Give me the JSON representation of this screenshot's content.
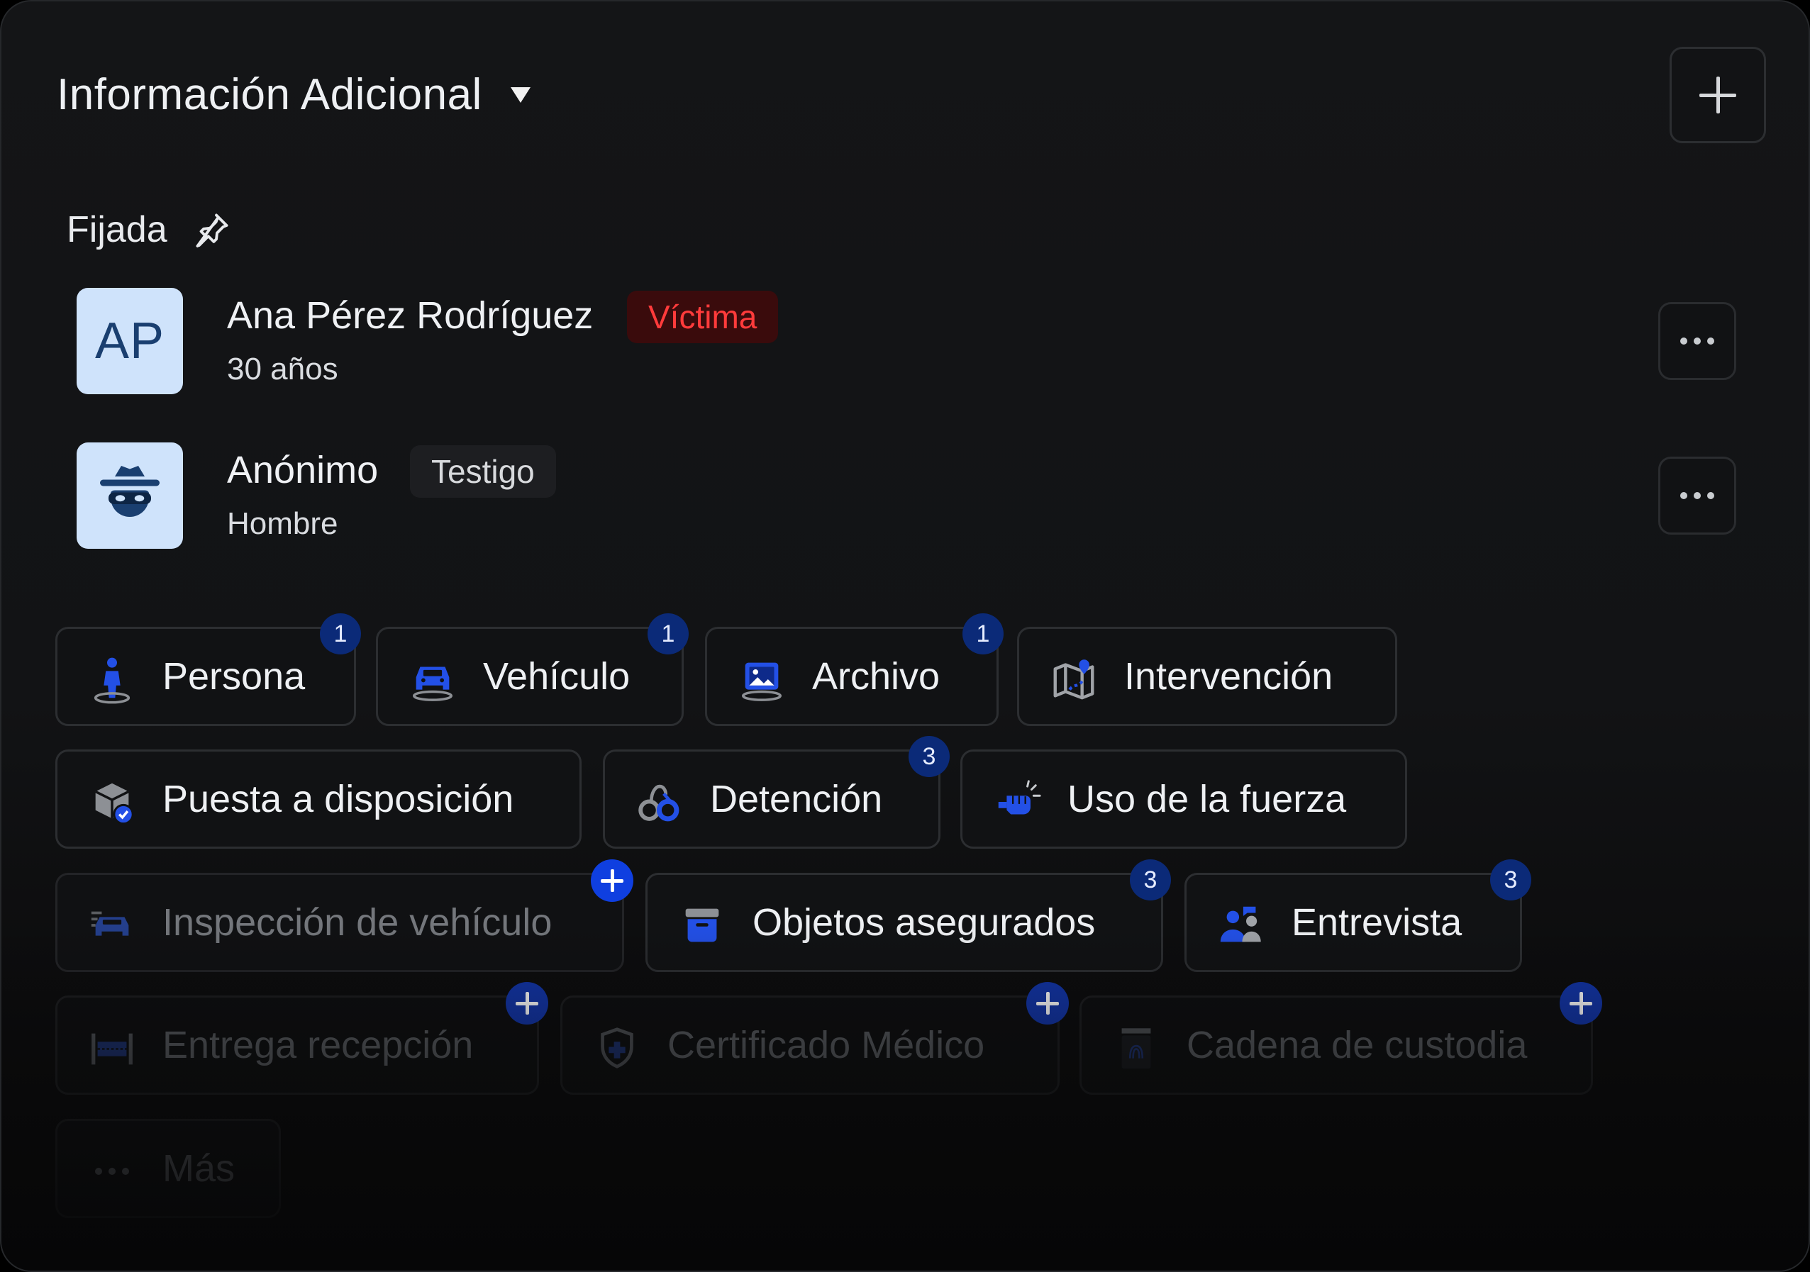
{
  "header": {
    "title": "Información Adicional",
    "add_button_icon": "plus-icon",
    "dropdown_icon": "caret-down-icon"
  },
  "pinned": {
    "label": "Fijada",
    "icon": "pin-icon"
  },
  "people": [
    {
      "initials": "AP",
      "name": "Ana Pérez Rodríguez",
      "role": "Víctima",
      "detail": "30 años",
      "role_color": "#ff3b3b"
    },
    {
      "avatar_icon": "incognito-icon",
      "name": "Anónimo",
      "role": "Testigo",
      "detail": "Hombre"
    }
  ],
  "chips": [
    {
      "label": "Persona",
      "icon": "person-icon",
      "count": "1"
    },
    {
      "label": "Vehículo",
      "icon": "car-icon",
      "count": "1"
    },
    {
      "label": "Archivo",
      "icon": "image-icon",
      "count": "1"
    },
    {
      "label": "Intervención",
      "icon": "map-icon"
    },
    {
      "label": "Puesta a disposición",
      "icon": "package-check-icon"
    },
    {
      "label": "Detención",
      "icon": "handcuffs-icon",
      "count": "3"
    },
    {
      "label": "Uso de la fuerza",
      "icon": "fist-icon"
    },
    {
      "label": "Inspección de vehículo",
      "icon": "car-inspection-icon",
      "add": true
    },
    {
      "label": "Objetos asegurados",
      "icon": "archive-box-icon",
      "count": "3"
    },
    {
      "label": "Entrevista",
      "icon": "people-icon",
      "count": "3"
    },
    {
      "label": "Entrega recepción",
      "icon": "handover-icon",
      "add": true
    },
    {
      "label": "Certificado Médico",
      "icon": "shield-medical-icon",
      "add": true
    },
    {
      "label": "Cadena de custodia",
      "icon": "fingerprint-evidence-icon",
      "add": true
    },
    {
      "label": "Más",
      "icon": "more-dots-icon"
    }
  ],
  "colors": {
    "accent": "#0f3fe0",
    "count_badge": "#0b2a78",
    "icon_blue": "#1f47e0",
    "avatar_bg": "#cfe3fb"
  }
}
